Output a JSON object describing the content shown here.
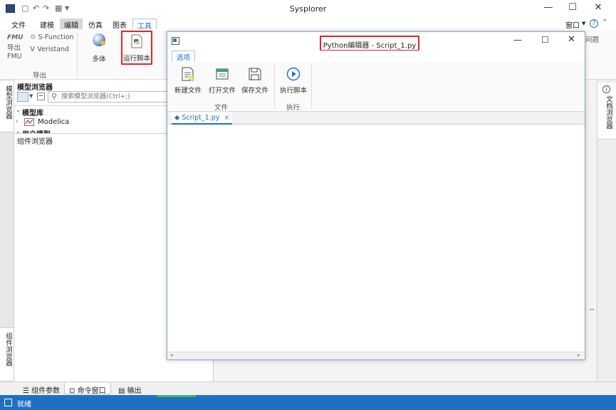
{
  "app": {
    "title": "Sysplorer",
    "window_controls": {
      "minimize": "—",
      "maximize": "☐",
      "close": "✕"
    }
  },
  "menu": {
    "tabs": [
      "文件",
      "建模",
      "编辑",
      "仿真",
      "图表",
      "工具"
    ],
    "right": {
      "window": "窗口",
      "help": "?"
    }
  },
  "ribbon": {
    "fmu_export_label": "导出\nFMU",
    "sfunction_label": "S-Function",
    "veristand_label": "Veristand",
    "export_group": "导出",
    "multibody_label": "多体",
    "run_script_label": "运行脚本",
    "right_fragment": "问题"
  },
  "left_panel": {
    "strip_label_model": "模型浏览器",
    "strip_label_component": "组件浏览器",
    "title": "模型浏览器",
    "search_placeholder": "搜索模型浏览器(Ctrl+;)",
    "section_model_lib": "模型库",
    "tree_item_modelica": "Modelica",
    "section_user_models": "用户模型",
    "component_browser_title": "组件浏览器"
  },
  "right_panel": {
    "strip_label": "文档浏览器"
  },
  "bottom_tabs": [
    {
      "label": "组件参数"
    },
    {
      "label": "命令窗口"
    },
    {
      "label": "输出"
    }
  ],
  "status": {
    "text": "就绪"
  },
  "python_editor": {
    "title": "Python编辑器 - Script_1.py",
    "options_tab": "选项",
    "buttons": {
      "new_file": "新建文件",
      "open_file": "打开文件",
      "save_file": "保存文件",
      "run_script": "执行脚本"
    },
    "groups": {
      "file": "文件",
      "run": "执行"
    },
    "file_tab": "Script_1.py",
    "file_tab_close": "×"
  },
  "colors": {
    "accent": "#1f70c1",
    "highlight_box": "#e0262b"
  }
}
